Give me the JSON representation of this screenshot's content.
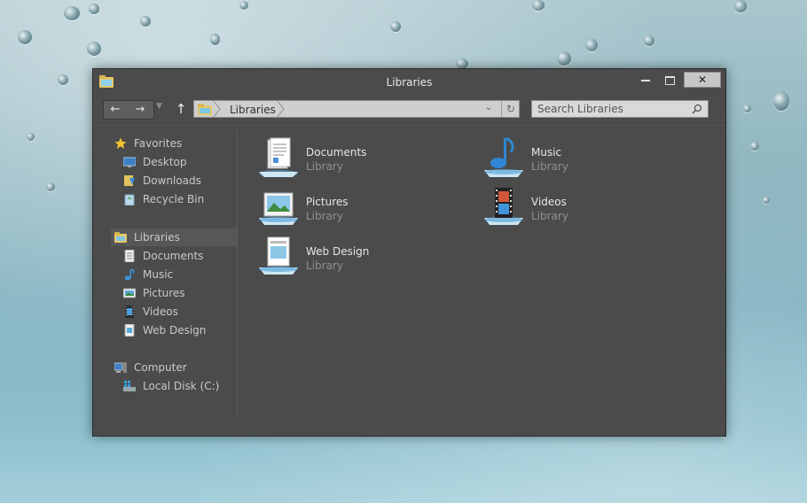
{
  "window": {
    "title": "Libraries",
    "close_glyph": "✕"
  },
  "toolbar": {
    "back_glyph": "←",
    "forward_glyph": "→",
    "recent_glyph": "▼",
    "up_glyph": "↑"
  },
  "address": {
    "crumb": "Libraries",
    "dropdown_glyph": "⌄",
    "refresh_glyph": "↻"
  },
  "search": {
    "placeholder": "Search Libraries"
  },
  "nav": {
    "favorites": {
      "label": "Favorites",
      "items": [
        {
          "label": "Desktop"
        },
        {
          "label": "Downloads"
        },
        {
          "label": "Recycle Bin"
        }
      ]
    },
    "libraries": {
      "label": "Libraries",
      "items": [
        {
          "label": "Documents"
        },
        {
          "label": "Music"
        },
        {
          "label": "Pictures"
        },
        {
          "label": "Videos"
        },
        {
          "label": "Web Design"
        }
      ]
    },
    "computer": {
      "label": "Computer",
      "items": [
        {
          "label": "Local Disk (C:)"
        }
      ]
    }
  },
  "content": {
    "items": [
      {
        "name": "Documents",
        "type": "Library",
        "icon": "documents-library-icon"
      },
      {
        "name": "Music",
        "type": "Library",
        "icon": "music-library-icon"
      },
      {
        "name": "Pictures",
        "type": "Library",
        "icon": "pictures-library-icon"
      },
      {
        "name": "Videos",
        "type": "Library",
        "icon": "videos-library-icon"
      },
      {
        "name": "Web Design",
        "type": "Library",
        "icon": "web-design-library-icon"
      }
    ]
  },
  "colors": {
    "window_bg": "#4b4b4b",
    "text_primary": "#e6e6e6",
    "text_secondary": "#8f8f8f",
    "nav_text": "#c9c9c9",
    "accent_blue": "#5aa7d9"
  }
}
